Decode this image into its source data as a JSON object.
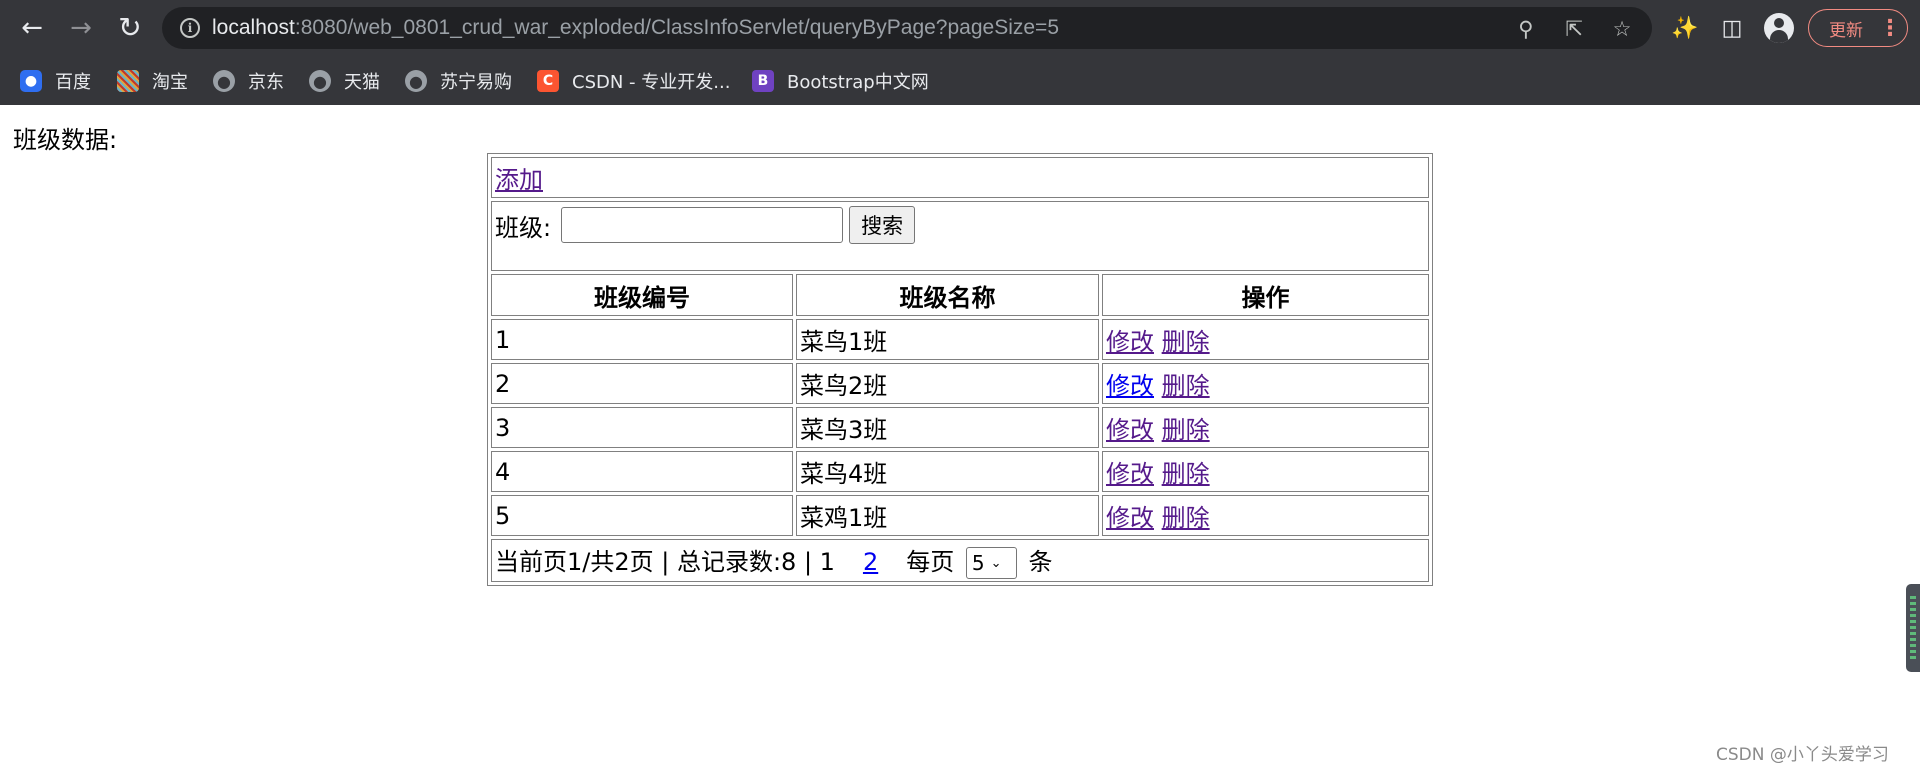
{
  "browser": {
    "url_host": "localhost",
    "url_rest": ":8080/web_0801_crud_war_exploded/ClassInfoServlet/queryByPage?pageSize=5",
    "update_label": "更新",
    "bookmarks": [
      {
        "label": "百度",
        "icon": "baidu-icon"
      },
      {
        "label": "淘宝",
        "icon": "taobao-icon"
      },
      {
        "label": "京东",
        "icon": "globe-icon"
      },
      {
        "label": "天猫",
        "icon": "globe-icon"
      },
      {
        "label": "苏宁易购",
        "icon": "globe-icon"
      },
      {
        "label": "CSDN - 专业开发...",
        "icon": "csdn-icon"
      },
      {
        "label": "Bootstrap中文网",
        "icon": "bootstrap-icon"
      }
    ]
  },
  "page": {
    "title": "班级数据:",
    "add_link": "添加",
    "search_label": "班级:",
    "search_value": "",
    "search_button": "搜索",
    "columns": [
      "班级编号",
      "班级名称",
      "操作"
    ],
    "rows": [
      {
        "id": "1",
        "name": "菜鸟1班",
        "edit": "修改",
        "delete": "删除"
      },
      {
        "id": "2",
        "name": "菜鸟2班",
        "edit": "修改",
        "delete": "删除"
      },
      {
        "id": "3",
        "name": "菜鸟3班",
        "edit": "修改",
        "delete": "删除"
      },
      {
        "id": "4",
        "name": "菜鸟4班",
        "edit": "修改",
        "delete": "删除"
      },
      {
        "id": "5",
        "name": "菜鸡1班",
        "edit": "修改",
        "delete": "删除"
      }
    ],
    "pager": {
      "summary": "当前页1/共2页 | 总记录数:8 | 1",
      "page2": "2",
      "per_page_label": "每页",
      "page_size": "5",
      "unit": "条"
    },
    "watermark": "CSDN @小丫头爱学习"
  }
}
